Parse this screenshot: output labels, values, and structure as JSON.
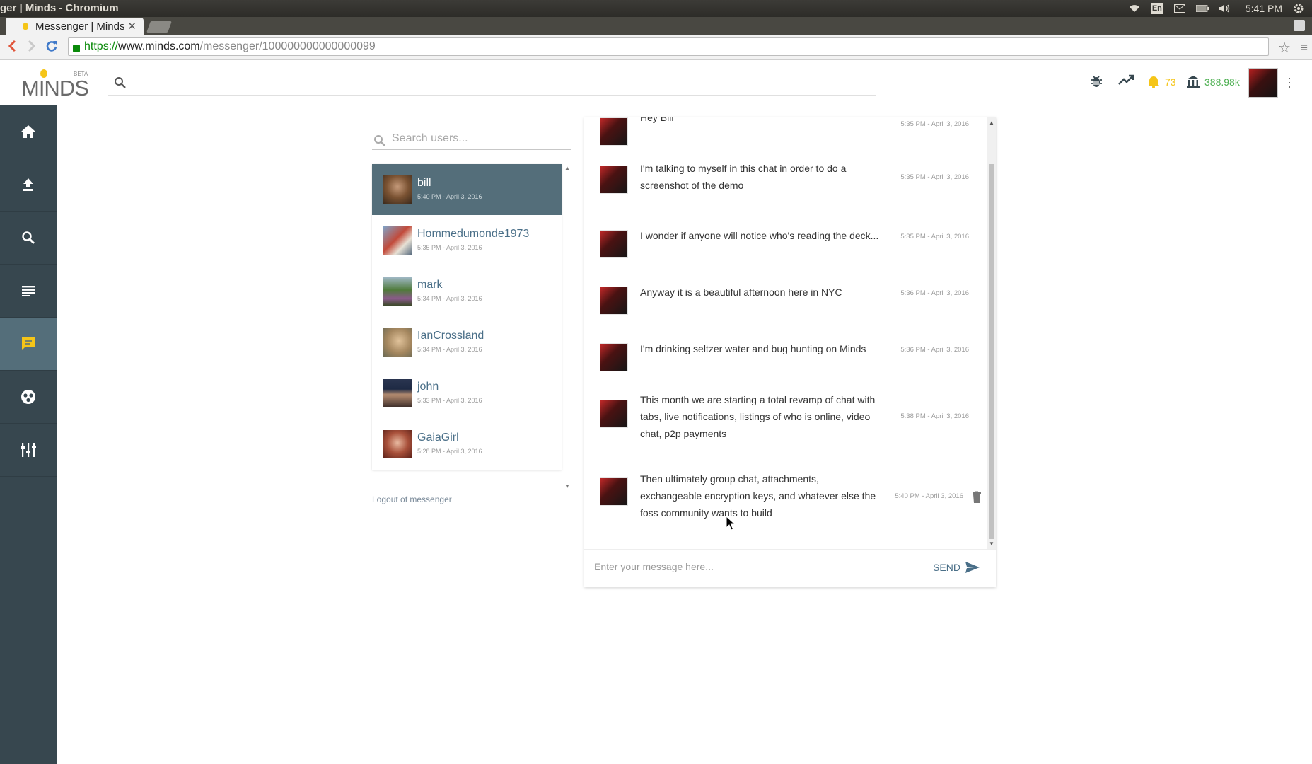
{
  "os": {
    "window_title": "ger | Minds - Chromium",
    "keyboard": "En",
    "time": "5:41 PM"
  },
  "browser": {
    "tab_title": "Messenger | Minds",
    "tab_close": "✕",
    "url_https": "https://",
    "url_host": "www.minds.com",
    "url_path": "/messenger/100000000000000099"
  },
  "header": {
    "logo_text": "MINDS",
    "logo_badge": "BETA",
    "search_placeholder": "",
    "notifications_count": "73",
    "wallet_amount": "388.98k"
  },
  "colors": {
    "sidebar": "#37474f",
    "sidebar_active": "#546e7a",
    "accent_link": "#4a6f88",
    "notification": "#f5c518",
    "wallet": "#4caf50"
  },
  "sidebar": {
    "items": [
      {
        "icon": "home-icon"
      },
      {
        "icon": "upload-icon"
      },
      {
        "icon": "search-icon"
      },
      {
        "icon": "newsfeed-icon"
      },
      {
        "icon": "messenger-icon",
        "active": true
      },
      {
        "icon": "groups-icon"
      },
      {
        "icon": "admin-icon"
      }
    ]
  },
  "conversations": {
    "search_placeholder": "Search users...",
    "logout_label": "Logout of messenger",
    "items": [
      {
        "name": "bill",
        "timestamp": "5:40 PM - April 3, 2016",
        "active": true
      },
      {
        "name": "Hommedumonde1973",
        "timestamp": "5:35 PM - April 3, 2016"
      },
      {
        "name": "mark",
        "timestamp": "5:34 PM - April 3, 2016"
      },
      {
        "name": "IanCrossland",
        "timestamp": "5:34 PM - April 3, 2016"
      },
      {
        "name": "john",
        "timestamp": "5:33 PM - April 3, 2016"
      },
      {
        "name": "GaiaGirl",
        "timestamp": "5:28 PM - April 3, 2016"
      }
    ]
  },
  "chat": {
    "messages": [
      {
        "text": "Hey Bill",
        "timestamp": "5:35 PM - April 3, 2016"
      },
      {
        "text": "I'm talking to myself in this chat in order to do a screenshot of the demo",
        "timestamp": "5:35 PM - April 3, 2016"
      },
      {
        "text": "I wonder if anyone will notice who's reading the deck...",
        "timestamp": "5:35 PM - April 3, 2016"
      },
      {
        "text": "Anyway it is a beautiful afternoon here in NYC",
        "timestamp": "5:36 PM - April 3, 2016"
      },
      {
        "text": "I'm drinking seltzer water and bug hunting on Minds",
        "timestamp": "5:36 PM - April 3, 2016"
      },
      {
        "text": "This month we are starting a total revamp of chat with tabs, live notifications, listings of who is online, video chat, p2p payments",
        "timestamp": "5:38 PM - April 3, 2016"
      },
      {
        "text": "Then ultimately group chat, attachments, exchangeable encryption keys, and whatever else the foss community wants to build",
        "timestamp": "5:40 PM - April 3, 2016"
      }
    ],
    "composer_placeholder": "Enter your message here...",
    "send_label": "SEND"
  }
}
